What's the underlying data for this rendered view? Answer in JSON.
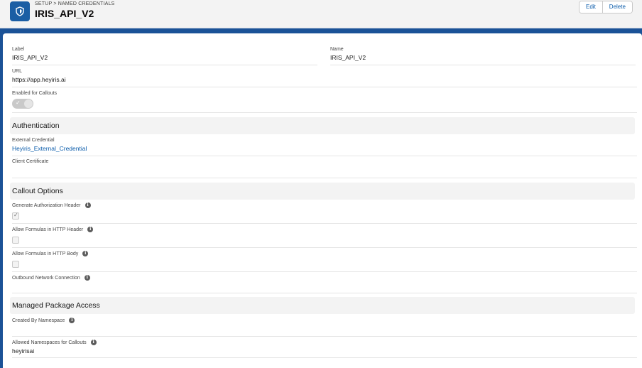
{
  "header": {
    "breadcrumb": "SETUP > NAMED CREDENTIALS",
    "title": "IRIS_API_V2",
    "edit_label": "Edit",
    "delete_label": "Delete",
    "icon": "shield-icon"
  },
  "details": {
    "label_label": "Label",
    "label_value": "IRIS_API_V2",
    "name_label": "Name",
    "name_value": "IRIS_API_V2",
    "url_label": "URL",
    "url_value": "https://app.heyiris.ai",
    "callouts_label": "Enabled for Callouts",
    "callouts_enabled": true
  },
  "authentication": {
    "heading": "Authentication",
    "external_credential_label": "External Credential",
    "external_credential_value": "Heyiris_External_Credential",
    "client_certificate_label": "Client Certificate",
    "client_certificate_value": ""
  },
  "callout_options": {
    "heading": "Callout Options",
    "gen_auth_label": "Generate Authorization Header",
    "gen_auth_checked": true,
    "formula_header_label": "Allow Formulas in HTTP Header",
    "formula_header_checked": false,
    "formula_body_label": "Allow Formulas in HTTP Body",
    "formula_body_checked": false,
    "outbound_label": "Outbound Network Connection",
    "outbound_value": ""
  },
  "managed_package": {
    "heading": "Managed Package Access",
    "created_by_label": "Created By Namespace",
    "created_by_value": "",
    "allowed_ns_label": "Allowed Namespaces for Callouts",
    "allowed_ns_value": "heyirisai"
  },
  "colors": {
    "brand_blue": "#1b5297",
    "link": "#0b5cab"
  }
}
